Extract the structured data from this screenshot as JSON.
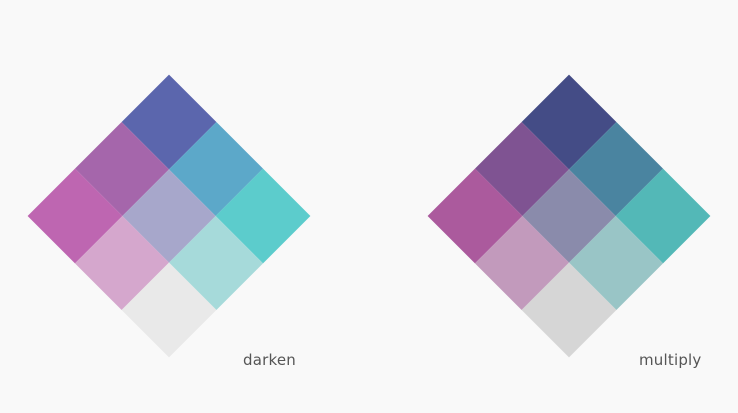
{
  "demos": [
    {
      "caption": "darken",
      "tiles": [
        [
          "#5b66ad",
          "#5ca8c9",
          "#5ccccc"
        ],
        [
          "#a566ab",
          "#a7a7cb",
          "#a6dada"
        ],
        [
          "#be66b1",
          "#d5a7cd",
          "#e9e9e9"
        ]
      ]
    },
    {
      "caption": "multiply",
      "tiles": [
        [
          "#444c86",
          "#4a84a0",
          "#53b8b7"
        ],
        [
          "#7f5392",
          "#8a8bab",
          "#99c5c6"
        ],
        [
          "#ab5a9d",
          "#c29abc",
          "#d6d6d6"
        ]
      ]
    }
  ]
}
